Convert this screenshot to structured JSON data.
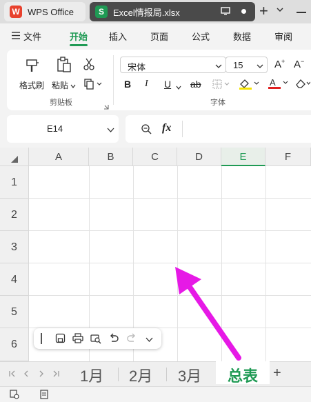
{
  "window": {
    "tab_wps": "WPS Office",
    "tab_file": "Excel情报局.xlsx",
    "new_tab_symbol": "+"
  },
  "menu": {
    "file": "文件",
    "items": [
      "开始",
      "插入",
      "页面",
      "公式",
      "数据",
      "审阅"
    ],
    "active_index": 0
  },
  "ribbon": {
    "format_painter": "格式刷",
    "paste": "粘贴",
    "clipboard_group": "剪贴板",
    "font_group": "字体",
    "font_name": "宋体",
    "font_size": "15",
    "bold": "B",
    "italic": "I",
    "underline": "U",
    "strike": "ab"
  },
  "formula_bar": {
    "name_box": "E14",
    "fx": "fx"
  },
  "grid": {
    "columns": [
      "A",
      "B",
      "C",
      "D",
      "E",
      "F"
    ],
    "selected_column": "E",
    "rows": [
      "1",
      "2",
      "3",
      "4",
      "5",
      "6"
    ]
  },
  "sheets": {
    "tabs": [
      "1月",
      "2月",
      "3月",
      "总表"
    ],
    "active": "总表",
    "add": "+"
  },
  "colors": {
    "accent": "#1f9a54",
    "arrow": "#e619e6",
    "wps_red": "#e8412d"
  }
}
